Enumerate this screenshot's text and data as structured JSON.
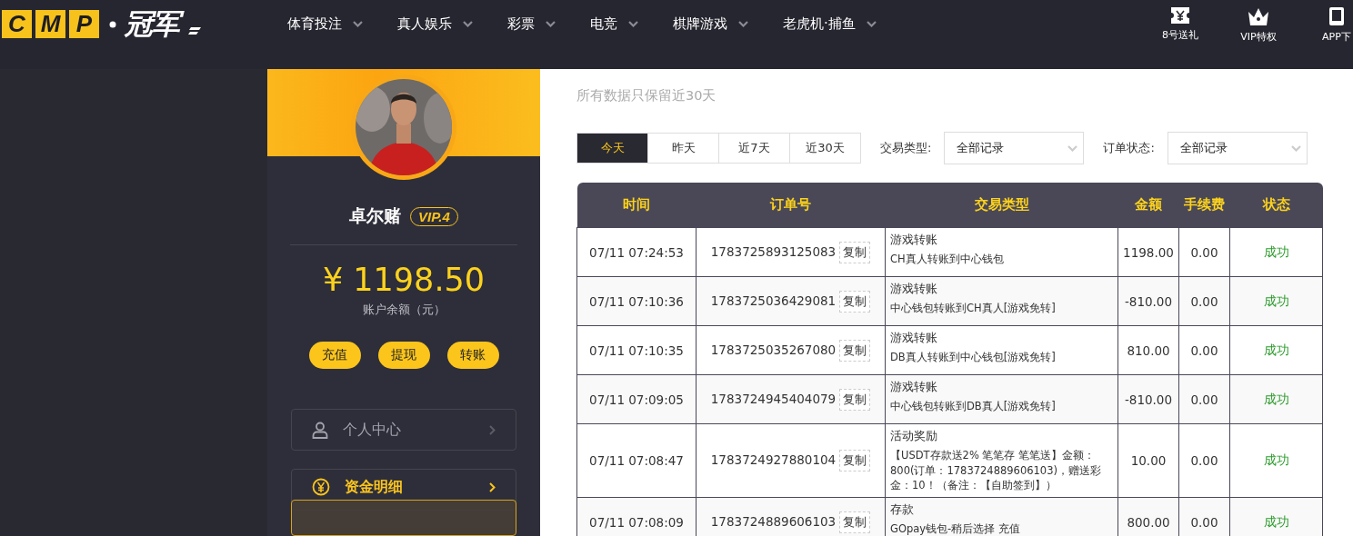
{
  "header": {
    "logo": {
      "letters": [
        "C",
        "M",
        "P"
      ],
      "name": "冠军"
    },
    "nav": [
      {
        "label": "体育投注"
      },
      {
        "label": "真人娱乐"
      },
      {
        "label": "彩票"
      },
      {
        "label": "电竞"
      },
      {
        "label": "棋牌游戏"
      },
      {
        "label": "老虎机·捕鱼"
      }
    ],
    "links": [
      {
        "label": "8号送礼",
        "kind": "gift"
      },
      {
        "label": "VIP特权",
        "kind": "crown"
      },
      {
        "label": "APP下",
        "kind": "phone"
      }
    ]
  },
  "profile": {
    "name": "卓尔赌",
    "vip": "VIP.4",
    "balance": "¥ 1198.50",
    "balance_label": "账户余额（元）",
    "actions": [
      "充值",
      "提现",
      "转账"
    ],
    "menu": [
      {
        "label": "个人中心",
        "kind": "user",
        "selected": false
      },
      {
        "label": "资金明细",
        "kind": "money",
        "selected": true
      }
    ]
  },
  "content": {
    "subtitle": "所有数据只保留近30天",
    "date_tabs": [
      {
        "label": "今天",
        "selected": true
      },
      {
        "label": "昨天",
        "selected": false
      },
      {
        "label": "近7天",
        "selected": false
      },
      {
        "label": "近30天",
        "selected": false
      }
    ],
    "filters": [
      {
        "label": "交易类型:",
        "value": "全部记录"
      },
      {
        "label": "订单状态:",
        "value": "全部记录"
      }
    ],
    "table": {
      "columns": [
        "时间",
        "订单号",
        "交易类型",
        "金额",
        "手续费",
        "状态"
      ],
      "rows": [
        {
          "time": "07/11 07:24:53",
          "order": "1783725893125083",
          "copy": "复制",
          "type": "游戏转账",
          "detail": "CH真人转账到中心钱包",
          "amount": "1198.00",
          "fee": "0.00",
          "status": "成功"
        },
        {
          "time": "07/11 07:10:36",
          "order": "1783725036429081",
          "copy": "复制",
          "type": "游戏转账",
          "detail": "中心钱包转账到CH真人[游戏免转]",
          "amount": "-810.00",
          "fee": "0.00",
          "status": "成功"
        },
        {
          "time": "07/11 07:10:35",
          "order": "1783725035267080",
          "copy": "复制",
          "type": "游戏转账",
          "detail": "DB真人转账到中心钱包[游戏免转]",
          "amount": "810.00",
          "fee": "0.00",
          "status": "成功"
        },
        {
          "time": "07/11 07:09:05",
          "order": "1783724945404079",
          "copy": "复制",
          "type": "游戏转账",
          "detail": "中心钱包转账到DB真人[游戏免转]",
          "amount": "-810.00",
          "fee": "0.00",
          "status": "成功"
        },
        {
          "time": "07/11 07:08:47",
          "order": "1783724927880104",
          "copy": "复制",
          "type": "活动奖励",
          "detail": "【USDT存款送2% 笔笔存 笔笔送】金额：800(订单：1783724889606103)，赠送彩金：10！（备注：【自助签到】）",
          "amount": "10.00",
          "fee": "0.00",
          "status": "成功"
        },
        {
          "time": "07/11 07:08:09",
          "order": "1783724889606103",
          "copy": "复制",
          "type": "存款",
          "detail": "GOpay钱包-稍后选择 充值",
          "amount": "800.00",
          "fee": "0.00",
          "status": "成功"
        }
      ]
    }
  }
}
